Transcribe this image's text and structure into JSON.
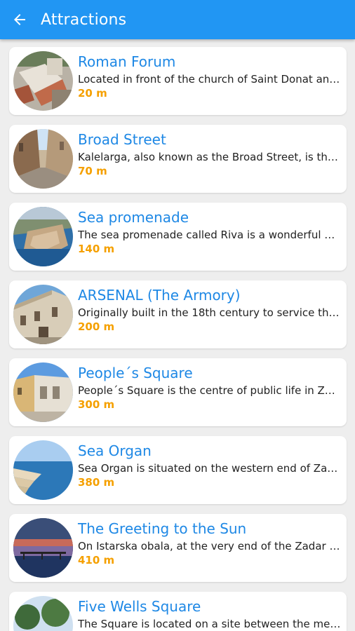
{
  "app_bar": {
    "title": "Attractions",
    "back_icon": "arrow-left-icon",
    "color": "#2196f3"
  },
  "attractions": [
    {
      "name": "Roman Forum",
      "description": "Located in front of the church of Saint Donat and...",
      "distance": "20 m"
    },
    {
      "name": "Broad Street",
      "description": "Kalelarga, also known as the Broad Street, is the...",
      "distance": "70 m"
    },
    {
      "name": "Sea promenade",
      "description": "The sea promenade called Riva is a wonderful pl...",
      "distance": "140 m"
    },
    {
      "name": "ARSENAL (The Armory)",
      "description": "Originally built in the 18th century to service the...",
      "distance": "200 m"
    },
    {
      "name": "People´s Square",
      "description": "People´s Square is the centre of public life in Zadar...",
      "distance": "300 m"
    },
    {
      "name": "Sea Organ",
      "description": "Sea Organ is situated on the western end of Zadar...",
      "distance": "380 m"
    },
    {
      "name": "The Greeting to the Sun",
      "description": "On Istarska obala, at the very end of the Zadar pe...",
      "distance": "410 m"
    },
    {
      "name": "Five Wells Square",
      "description": "The Square is located on a site between the med...",
      "distance": ""
    }
  ],
  "colors": {
    "title_text": "#1e88e5",
    "distance_text": "#f5a000",
    "background": "#eeeeee"
  }
}
